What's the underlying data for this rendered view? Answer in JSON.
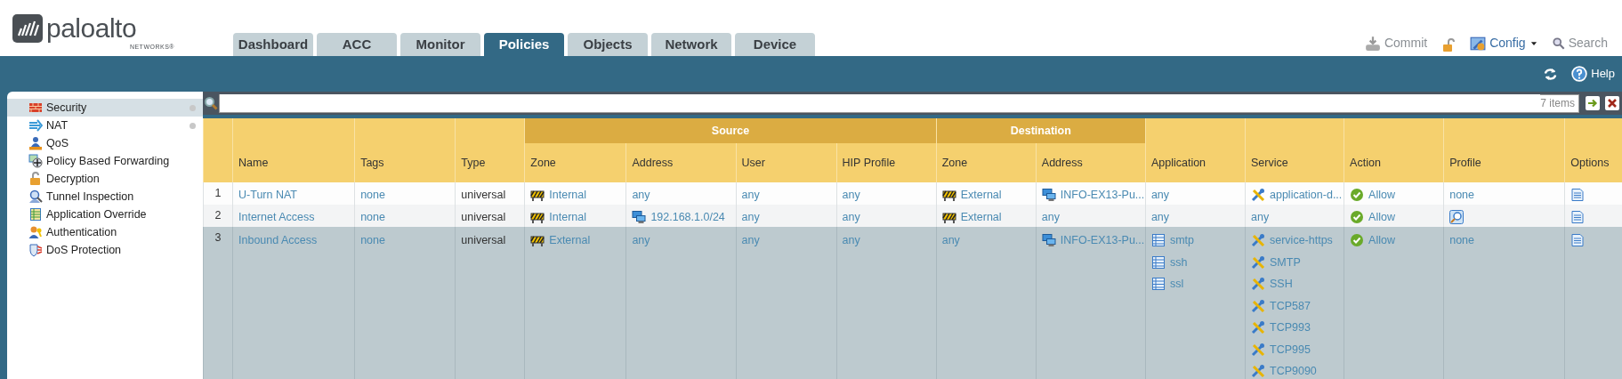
{
  "logo": {
    "name": "paloalto",
    "sub": "NETWORKS®"
  },
  "tabs": [
    {
      "label": "Dashboard",
      "selected": false
    },
    {
      "label": "ACC",
      "selected": false
    },
    {
      "label": "Monitor",
      "selected": false
    },
    {
      "label": "Policies",
      "selected": true
    },
    {
      "label": "Objects",
      "selected": false
    },
    {
      "label": "Network",
      "selected": false
    },
    {
      "label": "Device",
      "selected": false
    }
  ],
  "toolbar": [
    {
      "kind": "commit",
      "label": "Commit"
    },
    {
      "kind": "lock"
    },
    {
      "kind": "config",
      "label": "Config"
    },
    {
      "kind": "search",
      "label": "Search"
    }
  ],
  "subbar": [
    {
      "kind": "refresh"
    },
    {
      "kind": "help",
      "label": "Help"
    }
  ],
  "sidebar": {
    "items": [
      {
        "kind": "security",
        "label": "Security",
        "selected": true,
        "marked": true
      },
      {
        "kind": "nat",
        "label": "NAT",
        "selected": false,
        "marked": true
      },
      {
        "kind": "qos",
        "label": "QoS",
        "selected": false,
        "marked": false
      },
      {
        "kind": "pbf",
        "label": "Policy Based Forwarding",
        "selected": false,
        "marked": false
      },
      {
        "kind": "decryption",
        "label": "Decryption",
        "selected": false,
        "marked": false
      },
      {
        "kind": "tunnel",
        "label": "Tunnel Inspection",
        "selected": false,
        "marked": false
      },
      {
        "kind": "override",
        "label": "Application Override",
        "selected": false,
        "marked": false
      },
      {
        "kind": "auth",
        "label": "Authentication",
        "selected": false,
        "marked": false
      },
      {
        "kind": "dos",
        "label": "DoS Protection",
        "selected": false,
        "marked": false
      }
    ]
  },
  "filter": {
    "count": "7 items"
  },
  "table": {
    "header": [
      {
        "label": "Name"
      },
      {
        "label": "Tags"
      },
      {
        "label": "Type"
      },
      {
        "group": "Source",
        "columns": [
          {
            "label": "Zone"
          },
          {
            "label": "Address"
          },
          {
            "label": "User"
          },
          {
            "label": "HIP Profile"
          }
        ]
      },
      {
        "group": "Destination",
        "columns": [
          {
            "label": "Zone"
          },
          {
            "label": "Address"
          }
        ]
      },
      {
        "label": "Application"
      },
      {
        "label": "Service"
      },
      {
        "label": "Action"
      },
      {
        "label": "Profile"
      },
      {
        "label": "Options"
      }
    ],
    "rows": [
      {
        "index": "1",
        "selected": false,
        "cells": [
          [
            {
              "kind": "link",
              "text": "U-Turn NAT"
            }
          ],
          [
            {
              "kind": "value",
              "text": "none"
            }
          ],
          [
            {
              "kind": "plain",
              "text": "universal"
            }
          ],
          [
            {
              "kind": "zone",
              "text": "Internal"
            }
          ],
          [
            {
              "kind": "value",
              "text": "any"
            }
          ],
          [
            {
              "kind": "value",
              "text": "any"
            }
          ],
          [
            {
              "kind": "value",
              "text": "any"
            }
          ],
          [
            {
              "kind": "zone",
              "text": "External"
            }
          ],
          [
            {
              "kind": "address",
              "text": "INFO-EX13-Pu..."
            }
          ],
          [
            {
              "kind": "value",
              "text": "any"
            }
          ],
          [
            {
              "kind": "service",
              "text": "application-d..."
            }
          ],
          [
            {
              "kind": "allow",
              "text": "Allow"
            }
          ],
          [
            {
              "kind": "value",
              "text": "none"
            }
          ],
          [
            {
              "kind": "options"
            }
          ]
        ]
      },
      {
        "index": "2",
        "selected": false,
        "cells": [
          [
            {
              "kind": "link",
              "text": "Internet Access"
            }
          ],
          [
            {
              "kind": "value",
              "text": "none"
            }
          ],
          [
            {
              "kind": "plain",
              "text": "universal"
            }
          ],
          [
            {
              "kind": "zone",
              "text": "Internal"
            }
          ],
          [
            {
              "kind": "address",
              "text": "192.168.1.0/24"
            }
          ],
          [
            {
              "kind": "value",
              "text": "any"
            }
          ],
          [
            {
              "kind": "value",
              "text": "any"
            }
          ],
          [
            {
              "kind": "zone",
              "text": "External"
            }
          ],
          [
            {
              "kind": "value",
              "text": "any"
            }
          ],
          [
            {
              "kind": "value",
              "text": "any"
            }
          ],
          [
            {
              "kind": "value",
              "text": "any"
            }
          ],
          [
            {
              "kind": "allow",
              "text": "Allow"
            }
          ],
          [
            {
              "kind": "profile"
            }
          ],
          [
            {
              "kind": "options"
            }
          ]
        ]
      },
      {
        "index": "3",
        "selected": true,
        "cells": [
          [
            {
              "kind": "link",
              "text": "Inbound Access"
            }
          ],
          [
            {
              "kind": "value",
              "text": "none"
            }
          ],
          [
            {
              "kind": "plain",
              "text": "universal"
            }
          ],
          [
            {
              "kind": "zone",
              "text": "External"
            }
          ],
          [
            {
              "kind": "value",
              "text": "any"
            }
          ],
          [
            {
              "kind": "value",
              "text": "any"
            }
          ],
          [
            {
              "kind": "value",
              "text": "any"
            }
          ],
          [
            {
              "kind": "value",
              "text": "any"
            }
          ],
          [
            {
              "kind": "address",
              "text": "INFO-EX13-Pu..."
            }
          ],
          [
            {
              "kind": "application",
              "text": "smtp"
            },
            {
              "kind": "application",
              "text": "ssh"
            },
            {
              "kind": "application",
              "text": "ssl"
            }
          ],
          [
            {
              "kind": "service",
              "text": "service-https"
            },
            {
              "kind": "service",
              "text": "SMTP"
            },
            {
              "kind": "service",
              "text": "SSH"
            },
            {
              "kind": "service",
              "text": "TCP587"
            },
            {
              "kind": "service",
              "text": "TCP993"
            },
            {
              "kind": "service",
              "text": "TCP995"
            },
            {
              "kind": "service",
              "text": "TCP9090"
            }
          ],
          [
            {
              "kind": "allow",
              "text": "Allow"
            }
          ],
          [
            {
              "kind": "value",
              "text": "none"
            }
          ],
          [
            {
              "kind": "options"
            }
          ]
        ]
      }
    ]
  }
}
